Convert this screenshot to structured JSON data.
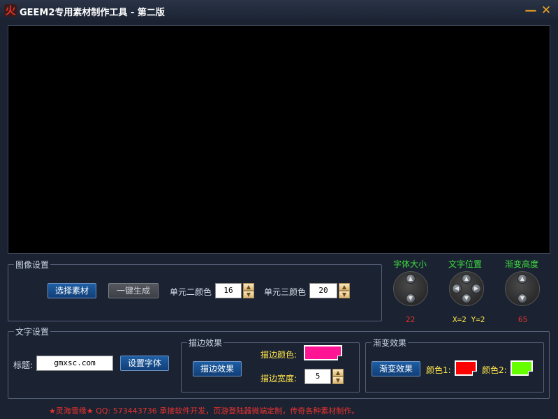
{
  "window": {
    "title": "GEEM2专用素材制作工具 - 第二版",
    "app_icon": "火",
    "min_icon": "—",
    "close_icon": "✕",
    "background_color": "#1b2333"
  },
  "image_settings": {
    "title": "图像设置",
    "select_button": "选择素材",
    "generate_button": "一键生成",
    "unit2_label": "单元二颜色",
    "unit2_value": "16",
    "unit3_label": "单元三颜色",
    "unit3_value": "20"
  },
  "dials": {
    "font_size": {
      "label": "字体大小",
      "value": "22"
    },
    "text_position": {
      "label": "文字位置",
      "value": "X=2 Y=2"
    },
    "gradient_height": {
      "label": "渐变高度",
      "value": "65"
    }
  },
  "text_settings": {
    "title": "文字设置",
    "caption_label": "标题:",
    "caption_value": "gmxsc.com",
    "set_font_button": "设置字体"
  },
  "stroke": {
    "title": "描边效果",
    "button": "描边效果",
    "color_label": "描边颜色:",
    "color": "#ff1493",
    "width_label": "描边宽度:",
    "width_value": "5"
  },
  "gradient": {
    "title": "渐变效果",
    "button": "渐变效果",
    "color1_label": "颜色1:",
    "color1": "#ff0000",
    "color2_label": "颜色2:",
    "color2": "#66ff00"
  },
  "footer": {
    "text": "★灵海雪缘★ QQ: 573443736 承接软件开发，页游登陆器微端定制，传奇各种素材制作。"
  }
}
